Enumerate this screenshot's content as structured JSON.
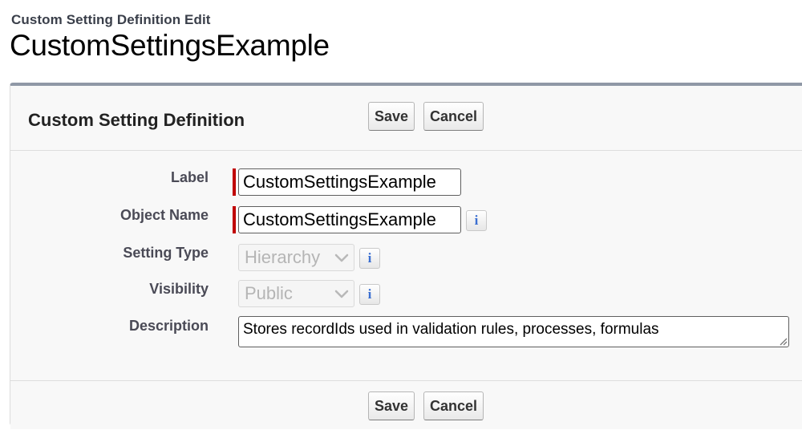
{
  "page": {
    "subtitle": "Custom Setting Definition Edit",
    "title": "CustomSettingsExample"
  },
  "panel": {
    "title": "Custom Setting Definition",
    "buttons": {
      "save": "Save",
      "cancel": "Cancel"
    }
  },
  "form": {
    "label": {
      "label": "Label",
      "value": "CustomSettingsExample",
      "required": true
    },
    "object_name": {
      "label": "Object Name",
      "value": "CustomSettingsExample",
      "required": true,
      "help_icon": "info-icon"
    },
    "setting_type": {
      "label": "Setting Type",
      "value": "Hierarchy",
      "disabled": true,
      "help_icon": "info-icon"
    },
    "visibility": {
      "label": "Visibility",
      "value": "Public",
      "disabled": true,
      "help_icon": "info-icon"
    },
    "description": {
      "label": "Description",
      "value": "Stores recordIds used in validation rules, processes, formulas"
    }
  },
  "info_glyph": "i",
  "colors": {
    "required": "#c00000",
    "panel_border": "#8f98a6",
    "info_icon": "#3b6fd1"
  }
}
